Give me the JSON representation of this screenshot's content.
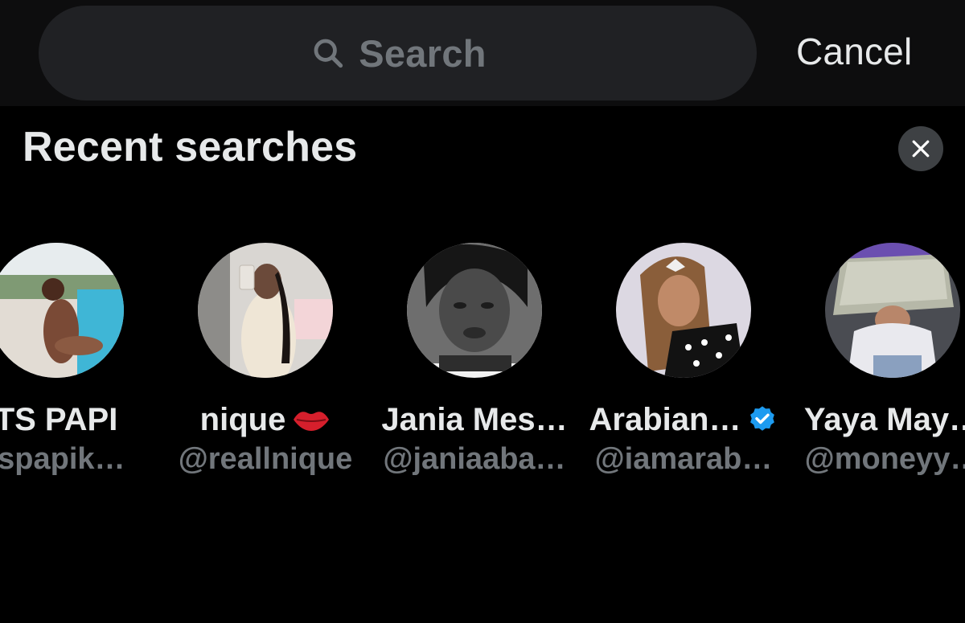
{
  "search": {
    "placeholder": "Search"
  },
  "header": {
    "cancel_label": "Cancel"
  },
  "recent": {
    "title": "Recent searches"
  },
  "people": [
    {
      "name": "TS PAPI",
      "handle": "tspapik…",
      "verified": false,
      "emoji": ""
    },
    {
      "name": "nique",
      "handle": "@reallnique",
      "verified": false,
      "emoji": "lips-icon"
    },
    {
      "name": "Jania Mes…",
      "handle": "@janiaaba…",
      "verified": false,
      "emoji": ""
    },
    {
      "name": "Arabian…",
      "handle": "@iamarab…",
      "verified": true,
      "emoji": ""
    },
    {
      "name": "Yaya May…",
      "handle": "@moneyy…",
      "verified": false,
      "emoji": ""
    }
  ],
  "colors": {
    "background": "#000000",
    "search_field": "#202124",
    "muted_text": "#71767b",
    "primary_text": "#e7e9ea",
    "verified_badge": "#1d9bf0"
  }
}
